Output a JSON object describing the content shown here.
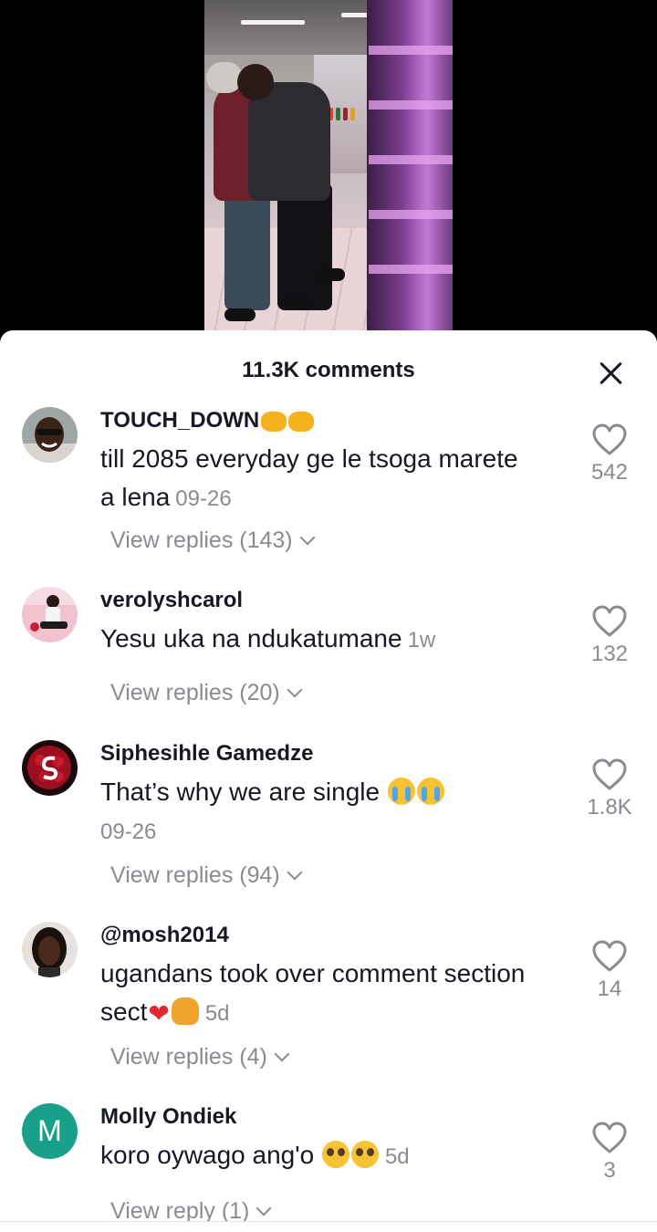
{
  "video": {
    "label": ""
  },
  "sheet": {
    "title": "11.3K comments"
  },
  "comments": [
    {
      "username": "TOUCH_DOWN",
      "username_emoji": "fist-bump-emoji",
      "text": "till 2085 everyday ge le tsoga marete a lena",
      "timestamp": "09-26",
      "replies": "View replies (143)",
      "likes": "542",
      "avatar": "photo"
    },
    {
      "username": "verolyshcarol",
      "text": "Yesu uka na ndukatumane",
      "timestamp": "1w",
      "replies": "View replies (20)",
      "likes": "132",
      "avatar": "photo"
    },
    {
      "username": "Siphesihle Gamedze",
      "text": "That’s why we are single",
      "text_emoji": "crying-emoji",
      "timestamp": "09-26",
      "replies": "View replies (94)",
      "likes": "1.8K",
      "avatar": "photo"
    },
    {
      "username": "@mosh2014",
      "text": "ugandans took over comment section sect",
      "text_emoji": "heart-person-emoji",
      "timestamp": "5d",
      "replies": "View replies (4)",
      "likes": "14",
      "avatar": "photo"
    },
    {
      "username": "Molly Ondiek",
      "text": "koro oywago ang'o",
      "text_emoji": "pleading-emoji",
      "timestamp": "5d",
      "replies": "View reply (1)",
      "likes": "3",
      "avatar": "letter",
      "avatar_letter": "M"
    }
  ],
  "colors": {
    "avatar_letter_bg": "#18a08a",
    "muted": "#8a8b91",
    "text": "#161823"
  }
}
